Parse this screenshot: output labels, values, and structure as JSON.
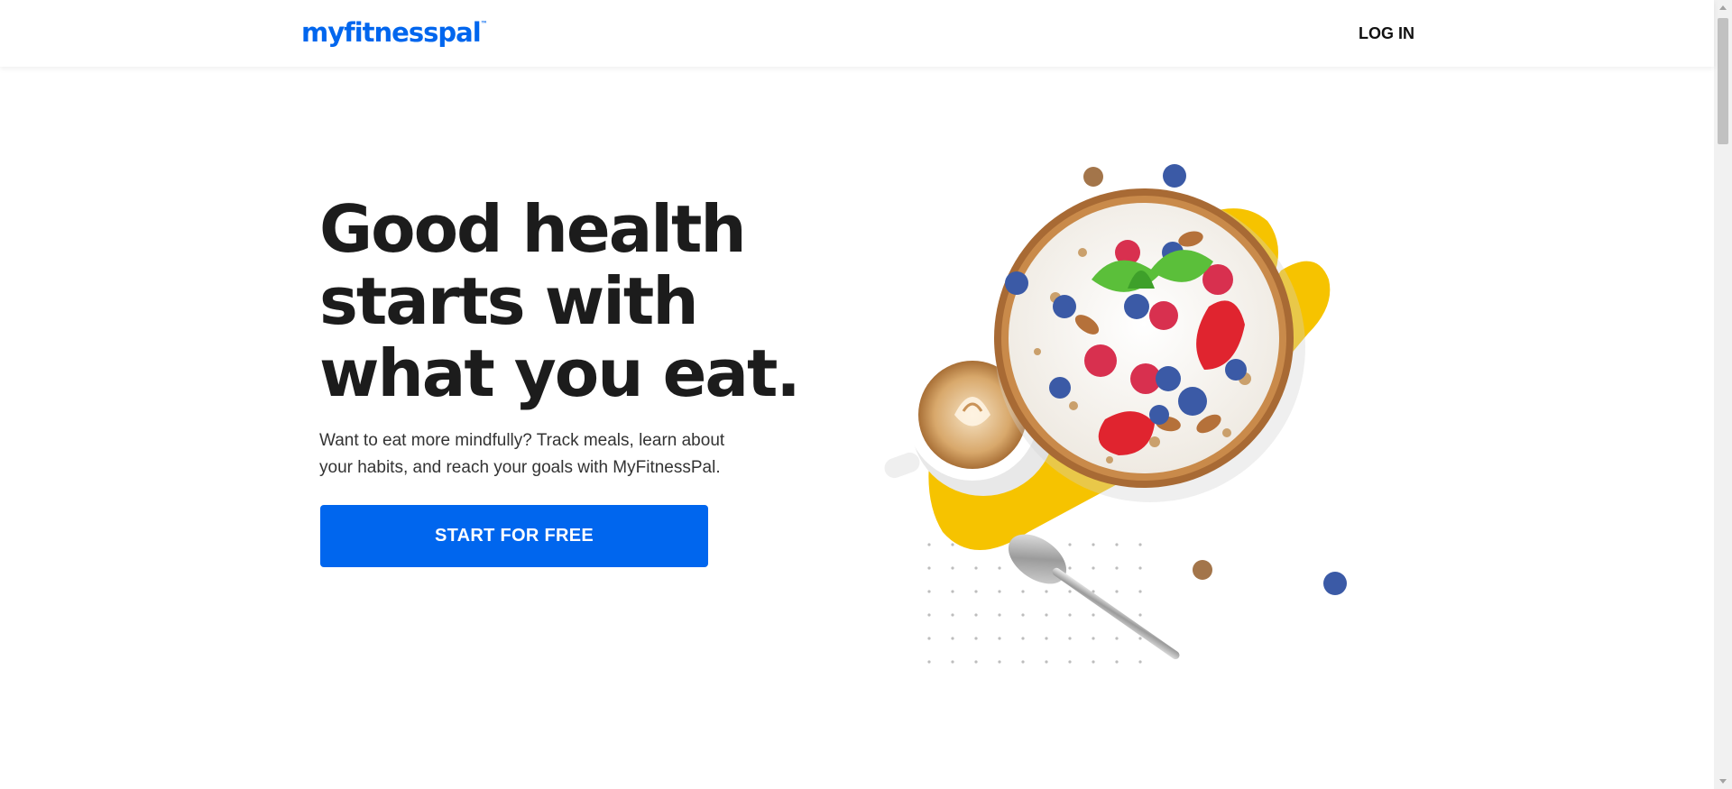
{
  "header": {
    "logo_text": "myfitnesspal",
    "logo_tm": "™",
    "login_label": "LOG IN"
  },
  "hero": {
    "headline_lines": [
      "Good health",
      "starts with",
      "what you eat."
    ],
    "subtext_lines": [
      "Want to eat more mindfully? Track meals, learn about",
      "your habits, and reach your goals with MyFitnessPal."
    ],
    "cta_label": "START FOR FREE"
  },
  "colors": {
    "brand_blue": "#0066ee",
    "accent_yellow": "#f6c300",
    "headline_text": "#1c1c1c"
  },
  "icons": {
    "scroll_up": "chevron-up-icon",
    "scroll_down": "chevron-down-icon"
  }
}
